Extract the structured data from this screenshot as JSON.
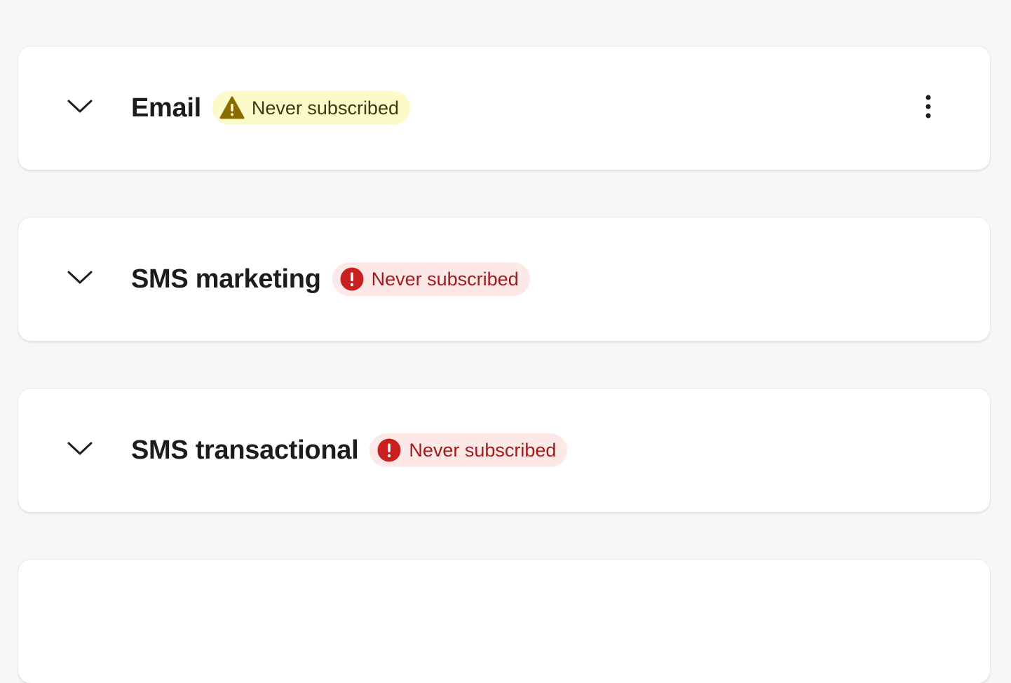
{
  "channels": [
    {
      "title": "Email",
      "status": {
        "label": "Never subscribed",
        "tone": "warning",
        "icon": "warning-triangle-icon",
        "background": "#fdfac9",
        "text_color": "#3f3a14",
        "icon_color": "#8a6b00"
      },
      "has_menu": true,
      "menu_icon": "more-vertical-icon"
    },
    {
      "title": "SMS marketing",
      "status": {
        "label": "Never subscribed",
        "tone": "critical",
        "icon": "alert-circle-icon",
        "background": "#fde8e8",
        "text_color": "#a21b1b",
        "icon_color": "#c8201f"
      },
      "has_menu": false
    },
    {
      "title": "SMS transactional",
      "status": {
        "label": "Never subscribed",
        "tone": "critical",
        "icon": "alert-circle-icon",
        "background": "#fde8e8",
        "text_color": "#a21b1b",
        "icon_color": "#c8201f"
      },
      "has_menu": false
    }
  ],
  "colors": {
    "page_background": "#f6f7f9",
    "card_background": "#ffffff",
    "title_text": "#1c1c1c"
  }
}
